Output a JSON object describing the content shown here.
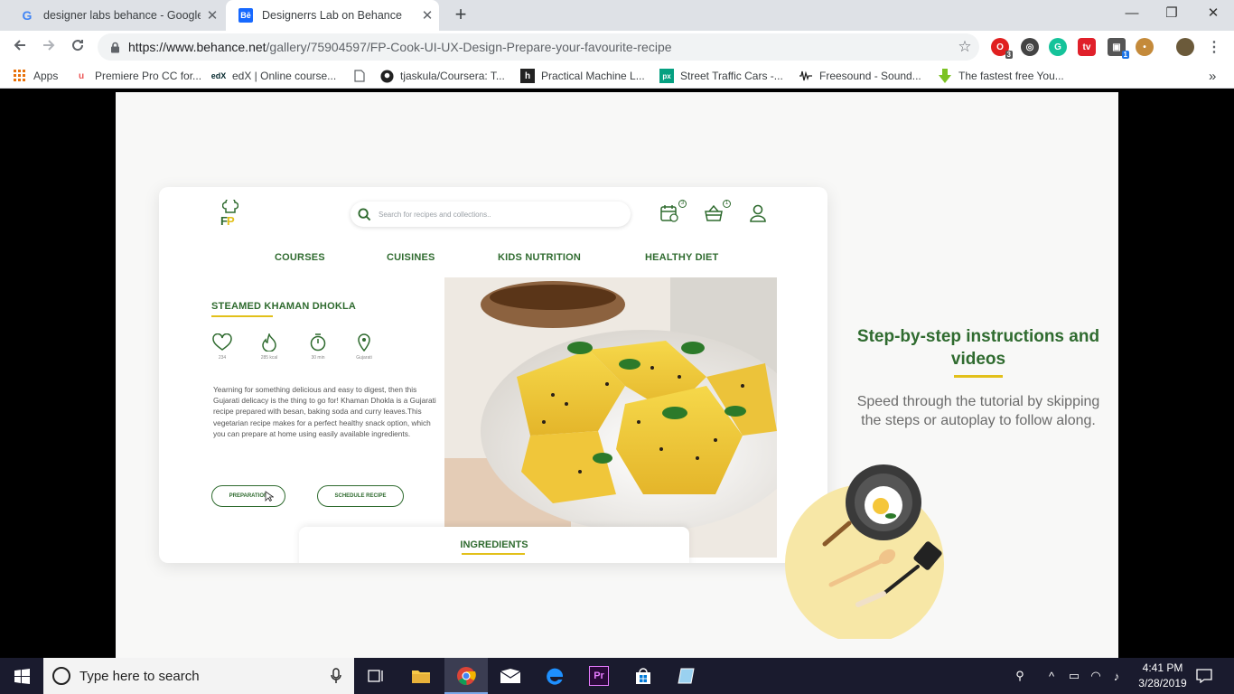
{
  "browser": {
    "tabs": [
      {
        "title": "designer labs behance - Google S",
        "favicon": "google-icon",
        "active": false
      },
      {
        "title": "Designerrs Lab on Behance",
        "favicon": "behance-icon",
        "active": true
      }
    ],
    "new_tab_symbol": "+",
    "window_controls": {
      "minimize": "—",
      "restore": "❐",
      "close": "✕"
    },
    "url_host": "https://www.behance.net",
    "url_path": "/gallery/75904597/FP-Cook-UI-UX-Design-Prepare-your-favourite-recipe",
    "extensions": [
      {
        "name": "opera-extension-icon",
        "badge": "3",
        "color": "#e02020"
      },
      {
        "name": "sync-extension-icon",
        "badge": "",
        "color": "#444444"
      },
      {
        "name": "grammarly-icon",
        "badge": "",
        "color": "#15c39a"
      },
      {
        "name": "tv-extension-icon",
        "badge": "",
        "color": "#e0202a"
      },
      {
        "name": "cube-extension-icon",
        "badge": "1",
        "color": "#555555"
      },
      {
        "name": "cookie-extension-icon",
        "badge": "",
        "color": "#c48a3a"
      }
    ],
    "bookmarks": [
      {
        "label": "Apps",
        "icon": "apps-grid-icon"
      },
      {
        "label": "Premiere Pro CC for...",
        "icon": "udemy-icon"
      },
      {
        "label": "edX | Online course...",
        "icon": "edx-icon"
      },
      {
        "label": "",
        "icon": "document-icon"
      },
      {
        "label": "tjaskula/Coursera: T...",
        "icon": "github-icon"
      },
      {
        "label": "Practical Machine L...",
        "icon": "h-icon"
      },
      {
        "label": "Street Traffic Cars -...",
        "icon": "px-icon"
      },
      {
        "label": "Freesound - Sound...",
        "icon": "waveform-icon"
      },
      {
        "label": "The fastest free You...",
        "icon": "download-arrow-icon"
      }
    ],
    "bookmarks_overflow": "»"
  },
  "app": {
    "logo_text_f": "F",
    "logo_text_p": "P",
    "search_placeholder": "Search for recipes and collections..",
    "header_badges": {
      "calendar": "3",
      "basket": "1"
    },
    "menu": [
      "COURSES",
      "CUISINES",
      "KIDS NUTRITION",
      "HEALTHY DIET"
    ],
    "dish_title": "STEAMED KHAMAN DHOKLA",
    "stats": [
      {
        "icon": "heart-icon",
        "value": "234"
      },
      {
        "icon": "flame-icon",
        "value": "285 kcal"
      },
      {
        "icon": "timer-icon",
        "value": "30 min"
      },
      {
        "icon": "location-pin-icon",
        "value": "Gujarati"
      }
    ],
    "description": "Yearning for something delicious and easy to digest, then this Gujarati delicacy is the thing to go for! Khaman Dhokla is a Gujarati recipe prepared with besan, baking soda and curry leaves.This vegetarian recipe makes for a perfect healthy snack option, which you can prepare at home using easily available ingredients.",
    "buttons": {
      "preparation": "PREPARATION",
      "schedule": "SCHEDULE RECIPE"
    },
    "ingredients_tab": "INGREDIENTS"
  },
  "feature": {
    "title": "Step-by-step instructions and videos",
    "description": "Speed through the tutorial by skipping the steps or autoplay to follow along."
  },
  "taskbar": {
    "search_placeholder": "Type here to search",
    "time": "4:41 PM",
    "date": "3/28/2019"
  },
  "colors": {
    "brand_green": "#2f6b2f",
    "brand_yellow": "#e2c01a",
    "behance_blue": "#1769ff"
  }
}
